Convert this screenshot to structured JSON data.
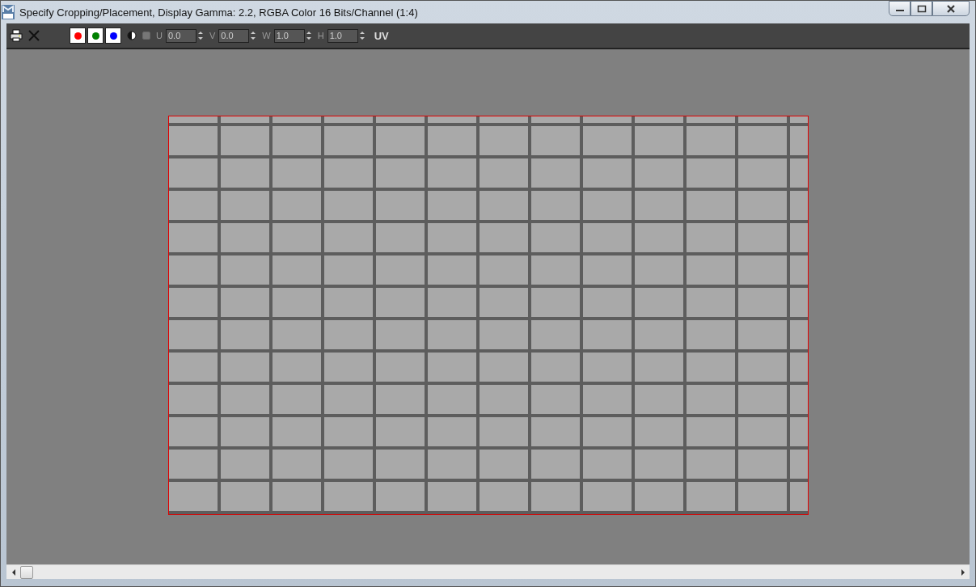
{
  "window": {
    "title": "Specify Cropping/Placement, Display Gamma: 2.2, RGBA Color 16 Bits/Channel (1:4)"
  },
  "toolbar": {
    "channels": [
      {
        "color": "#ff0000",
        "on": true
      },
      {
        "color": "#008000",
        "on": true
      },
      {
        "color": "#0000ff",
        "on": true
      }
    ],
    "fields": [
      {
        "label": "U",
        "value": "0.0"
      },
      {
        "label": "V",
        "value": "0.0"
      },
      {
        "label": "W",
        "value": "1.0"
      },
      {
        "label": "H",
        "value": "1.0"
      }
    ],
    "mode": "UV"
  }
}
